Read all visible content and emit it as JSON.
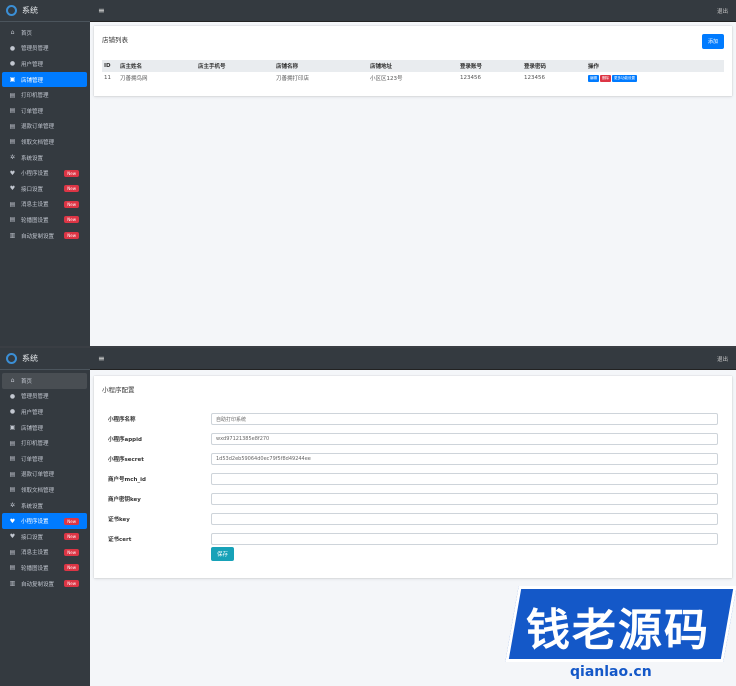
{
  "top_panel": {
    "brand": "系统",
    "logout": "退出",
    "sidebar": [
      {
        "icon": "home-icon",
        "glyph": "⌂",
        "label": "首页"
      },
      {
        "icon": "user-icon",
        "glyph": "●",
        "label": "管理员管理"
      },
      {
        "icon": "user-icon",
        "glyph": "●",
        "label": "用户管理"
      },
      {
        "icon": "store-icon",
        "glyph": "▣",
        "label": "店铺管理",
        "active": true
      },
      {
        "icon": "printer-icon",
        "glyph": "▤",
        "label": "打印机管理"
      },
      {
        "icon": "order-icon",
        "glyph": "▤",
        "label": "订单管理"
      },
      {
        "icon": "refund-icon",
        "glyph": "▤",
        "label": "退款订单管理"
      },
      {
        "icon": "coupon-icon",
        "glyph": "▤",
        "label": "领取文档管理"
      },
      {
        "icon": "gear-icon",
        "glyph": "✲",
        "label": "系统设置"
      },
      {
        "icon": "heart-icon",
        "glyph": "♥",
        "label": "小程序设置",
        "badge": "New"
      },
      {
        "icon": "heart-icon",
        "glyph": "♥",
        "label": "接口设置",
        "badge": "New"
      },
      {
        "icon": "list-icon",
        "glyph": "▤",
        "label": "消息主设置",
        "badge": "New"
      },
      {
        "icon": "list-icon",
        "glyph": "▤",
        "label": "轮播图设置",
        "badge": "New"
      },
      {
        "icon": "doc-icon",
        "glyph": "▥",
        "label": "自动复制设置",
        "badge": "New"
      }
    ],
    "card": {
      "title": "店铺列表",
      "add_button": "添加",
      "columns": [
        "ID",
        "店主姓名",
        "店主手机号",
        "店铺名称",
        "店铺地址",
        "登录账号",
        "登录密码",
        "操作"
      ],
      "rows": [
        {
          "cells": [
            "11",
            "刀善拥鸟网",
            "",
            "刀善拥打印店",
            "小区区123号",
            "123456",
            "123456"
          ],
          "actions": [
            "编辑",
            "删除",
            "更多功能设置"
          ]
        }
      ]
    }
  },
  "bottom_panel": {
    "brand": "系统",
    "logout": "退出",
    "sidebar": [
      {
        "icon": "home-icon",
        "glyph": "⌂",
        "label": "首页",
        "hover": true
      },
      {
        "icon": "user-icon",
        "glyph": "●",
        "label": "管理员管理"
      },
      {
        "icon": "user-icon",
        "glyph": "●",
        "label": "用户管理"
      },
      {
        "icon": "store-icon",
        "glyph": "▣",
        "label": "店铺管理"
      },
      {
        "icon": "printer-icon",
        "glyph": "▤",
        "label": "打印机管理"
      },
      {
        "icon": "order-icon",
        "glyph": "▤",
        "label": "订单管理"
      },
      {
        "icon": "refund-icon",
        "glyph": "▤",
        "label": "退款订单管理"
      },
      {
        "icon": "coupon-icon",
        "glyph": "▤",
        "label": "领取文档管理"
      },
      {
        "icon": "gear-icon",
        "glyph": "✲",
        "label": "系统设置"
      },
      {
        "icon": "heart-icon",
        "glyph": "♥",
        "label": "小程序设置",
        "badge": "New",
        "active": true
      },
      {
        "icon": "heart-icon",
        "glyph": "♥",
        "label": "接口设置",
        "badge": "New"
      },
      {
        "icon": "list-icon",
        "glyph": "▤",
        "label": "消息主设置",
        "badge": "New"
      },
      {
        "icon": "list-icon",
        "glyph": "▤",
        "label": "轮播图设置",
        "badge": "New"
      },
      {
        "icon": "doc-icon",
        "glyph": "▥",
        "label": "自动复制设置",
        "badge": "New"
      }
    ],
    "form": {
      "title": "小程序配置",
      "fields": [
        {
          "label": "小程序名称",
          "value": "自助打印系统"
        },
        {
          "label": "小程序appid",
          "value": "wxd97121385e8f270"
        },
        {
          "label": "小程序secret",
          "value": "1d53d2eb59064d0ec79f5f8d49244ee"
        },
        {
          "label": "商户号mch_id",
          "value": ""
        },
        {
          "label": "商户密钥key",
          "value": ""
        },
        {
          "label": "证书key",
          "value": ""
        },
        {
          "label": "证书cert",
          "value": ""
        }
      ],
      "save_button": "保存"
    }
  },
  "watermark": {
    "text": "钱老源码",
    "url": "qianlao.cn"
  }
}
